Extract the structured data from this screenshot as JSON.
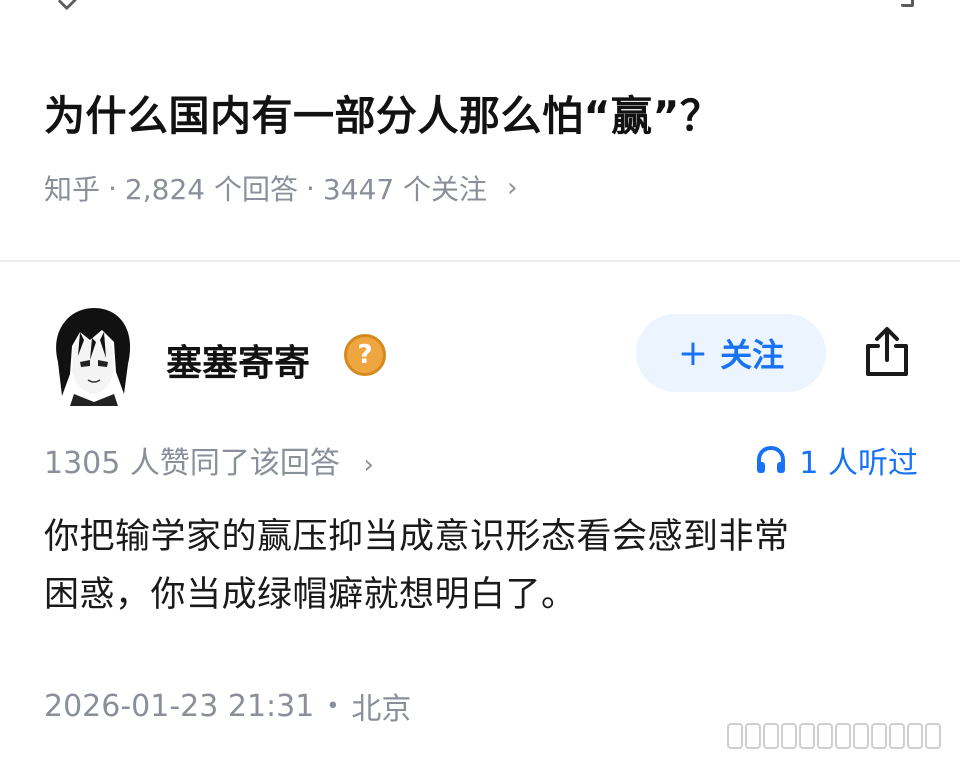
{
  "question": {
    "title": "为什么国内有一部分人那么怕“赢”？",
    "source": "知乎",
    "answers": "2,824 个回答",
    "followers": "3447 个关注",
    "separator": "·",
    "chevron": "›"
  },
  "author": {
    "name": "塞塞寄寄",
    "badge": "?",
    "avatar_icon": "avatar-anime-portrait"
  },
  "actions": {
    "follow_plus": "+",
    "follow_label": "关注",
    "share_icon": "share-icon"
  },
  "stats": {
    "likes": "1305 人赞同了该回答",
    "chevron": "›",
    "listen_icon": "headphones-icon",
    "listen_count": "1 人听过"
  },
  "answer": {
    "line1": "你把输学家的赢压抑当成意识形态看会感到非常",
    "line2": "困惑，你当成绿帽癖就想明白了。"
  },
  "footer": {
    "date": "2026-01-23 21:31",
    "dot": "•",
    "location": "北京"
  },
  "colors": {
    "accent": "#1772f6",
    "follow_bg": "#ebf4ff",
    "meta": "#8a8f99",
    "badge": "#f0a640"
  }
}
